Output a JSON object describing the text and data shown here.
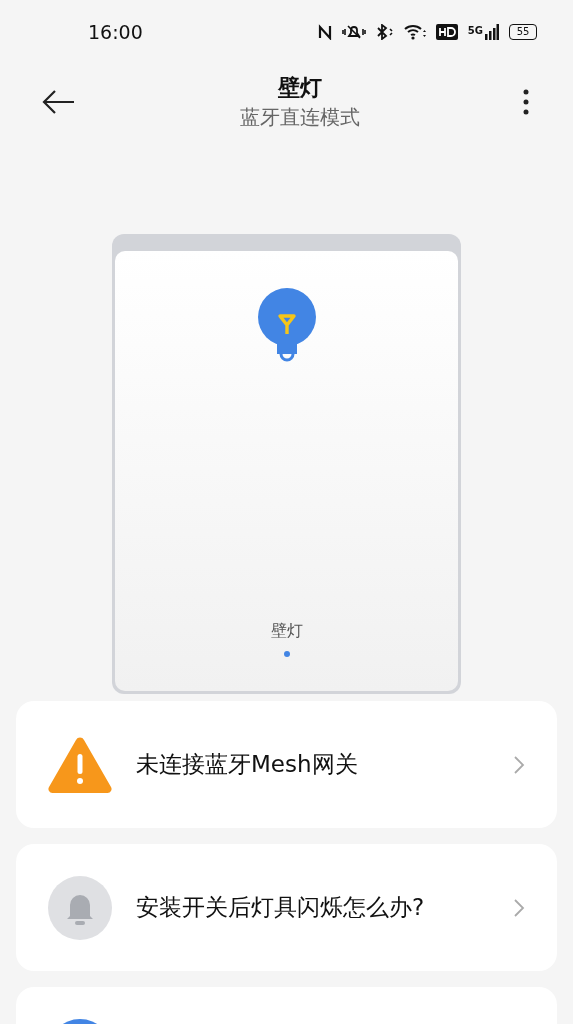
{
  "status_bar": {
    "time": "16:00",
    "network": "5G",
    "battery": "55"
  },
  "header": {
    "title": "壁灯",
    "subtitle": "蓝牙直连模式"
  },
  "switch_panel": {
    "label": "壁灯",
    "pages": [
      {
        "selected": true
      }
    ]
  },
  "cards": [
    {
      "kind": "warning",
      "text": "未连接蓝牙Mesh网关"
    },
    {
      "kind": "bell",
      "text": "安装开关后灯具闪烁怎么办?"
    },
    {
      "kind": "partial"
    }
  ]
}
